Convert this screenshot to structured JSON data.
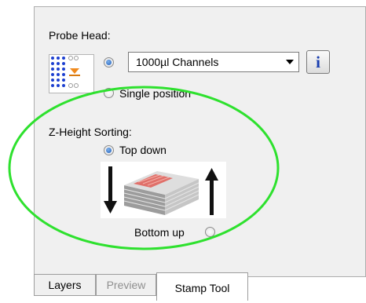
{
  "probe_head": {
    "label": "Probe Head:",
    "channels_select": "1000µl Channels",
    "info_button": "i",
    "single_position": "Single position",
    "selected": "channels"
  },
  "z_height": {
    "label": "Z-Height Sorting:",
    "top_down": "Top down",
    "bottom_up": "Bottom up",
    "selected": "top_down"
  },
  "tabs": [
    "Layers",
    "Preview",
    "Stamp Tool"
  ],
  "active_tab": "Stamp Tool",
  "disabled_tab": "Preview",
  "highlight_color": "#2ee12e",
  "icons": {
    "probe_head": "probe-head-grid-icon",
    "sorting": "stack-sort-icon"
  }
}
